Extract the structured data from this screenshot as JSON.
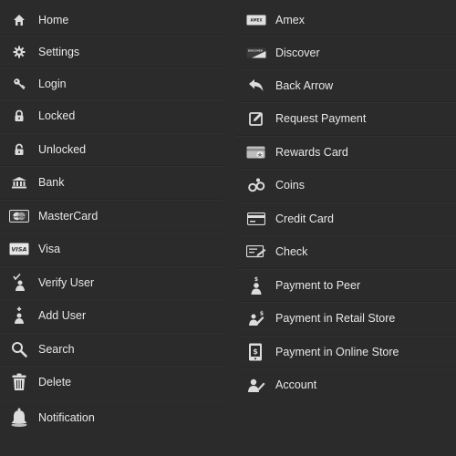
{
  "left_list": [
    {
      "label": "Home",
      "icon": "home-icon"
    },
    {
      "label": "Settings",
      "icon": "gear-icon"
    },
    {
      "label": "Login",
      "icon": "key-icon"
    },
    {
      "label": "Locked",
      "icon": "lock-icon"
    },
    {
      "label": "Unlocked",
      "icon": "unlock-icon"
    },
    {
      "label": "Bank",
      "icon": "bank-icon"
    },
    {
      "label": "MasterCard",
      "icon": "mastercard-icon"
    },
    {
      "label": "Visa",
      "icon": "visa-icon"
    },
    {
      "label": "Verify User",
      "icon": "verify-user-icon"
    },
    {
      "label": "Add User",
      "icon": "add-user-icon"
    },
    {
      "label": "Search",
      "icon": "search-icon"
    },
    {
      "label": "Delete",
      "icon": "trash-icon"
    },
    {
      "label": "Notification",
      "icon": "bell-icon"
    }
  ],
  "right_list": [
    {
      "label": "Amex",
      "icon": "amex-icon"
    },
    {
      "label": "Discover",
      "icon": "discover-icon"
    },
    {
      "label": "Back Arrow",
      "icon": "back-arrow-icon"
    },
    {
      "label": "Request Payment",
      "icon": "request-payment-icon"
    },
    {
      "label": "Rewards Card",
      "icon": "rewards-card-icon"
    },
    {
      "label": "Coins",
      "icon": "coins-icon"
    },
    {
      "label": "Credit Card",
      "icon": "credit-card-icon"
    },
    {
      "label": "Check",
      "icon": "check-icon"
    },
    {
      "label": "Payment to Peer",
      "icon": "peer-payment-icon"
    },
    {
      "label": "Payment in Retail Store",
      "icon": "retail-payment-icon"
    },
    {
      "label": "Payment in Online Store",
      "icon": "online-payment-icon"
    },
    {
      "label": "Account",
      "icon": "account-icon"
    }
  ],
  "card_marks": {
    "amex": "AMEX",
    "discover": "DISCOVER",
    "visa": "VISA",
    "mastercard": "MasterCard"
  },
  "colors": {
    "background": "#2b2b2b",
    "text": "#e8e8e8",
    "icon": "#dcdcdc"
  }
}
